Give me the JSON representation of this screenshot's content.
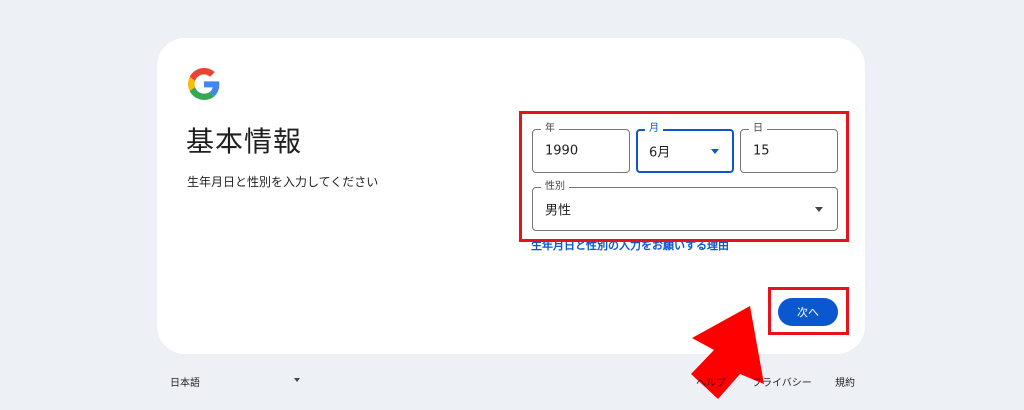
{
  "header": {
    "logo_letter": "G",
    "title": "基本情報",
    "subtitle": "生年月日と性別を入力してください"
  },
  "form": {
    "year": {
      "label": "年",
      "value": "1990"
    },
    "month": {
      "label": "月",
      "value": "6月"
    },
    "day": {
      "label": "日",
      "value": "15"
    },
    "gender": {
      "label": "性別",
      "value": "男性"
    }
  },
  "reason_link": "生年月日と性別の入力をお願いする理由",
  "next_button": "次へ",
  "footer": {
    "language": "日本語",
    "help": "ヘルプ",
    "privacy": "プライバシー",
    "terms": "規約"
  },
  "colors": {
    "accent": "#0b57d0",
    "highlight": "#e8121d",
    "background": "#edf0f5"
  }
}
